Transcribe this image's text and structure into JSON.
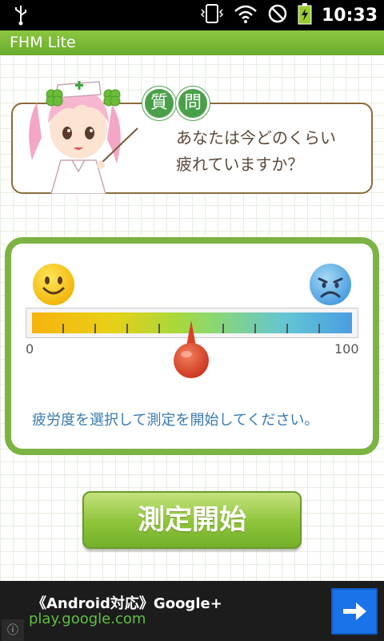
{
  "status_bar": {
    "time": "10:33"
  },
  "app": {
    "title": "FHM Lite"
  },
  "question": {
    "badge_chars": [
      "質",
      "問"
    ],
    "text": "あなたは今どのくらい\n疲れていますか？"
  },
  "scale": {
    "min_label": "0",
    "max_label": "100",
    "value": 50,
    "instruction": "疲労度を選択して測定を開始してください。"
  },
  "start_button": {
    "label": "測定開始"
  },
  "ad": {
    "title": "《Android対応》Google+",
    "url": "play.google.com"
  },
  "colors": {
    "accent_green": "#7cb342",
    "title_bar": "#7bbb36",
    "badge_green": "#4aa04a",
    "instruction_blue": "#3a7ab0",
    "ad_url_green": "#5fbf3f",
    "ad_button_blue": "#1a73e8"
  }
}
